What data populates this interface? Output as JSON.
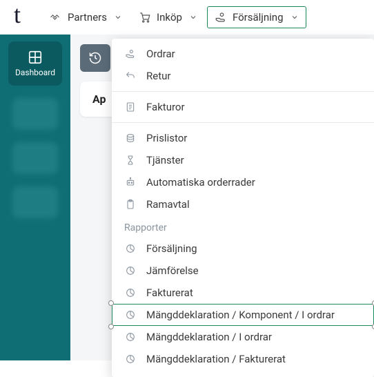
{
  "logo": "t",
  "topnav": {
    "partners": "Partners",
    "purchase": "Inköp",
    "sales": "Försäljning"
  },
  "sidebar": {
    "dashboard": "Dashboard"
  },
  "main": {
    "card_title_fragment": "Ap"
  },
  "menu": {
    "orders": "Ordrar",
    "returns": "Retur",
    "invoices": "Fakturor",
    "pricelists": "Prislistor",
    "services": "Tjänster",
    "auto_order_lines": "Automatiska orderrader",
    "framework_agreements": "Ramavtal",
    "reports_header": "Rapporter",
    "rpt_sales": "Försäljning",
    "rpt_compare": "Jämförelse",
    "rpt_invoiced": "Fakturerat",
    "rpt_qty_component_in_orders": "Mängddeklaration / Komponent / I ordrar",
    "rpt_qty_in_orders": "Mängddeklaration / I ordrar",
    "rpt_qty_invoiced": "Mängddeklaration / Fakturerat"
  }
}
